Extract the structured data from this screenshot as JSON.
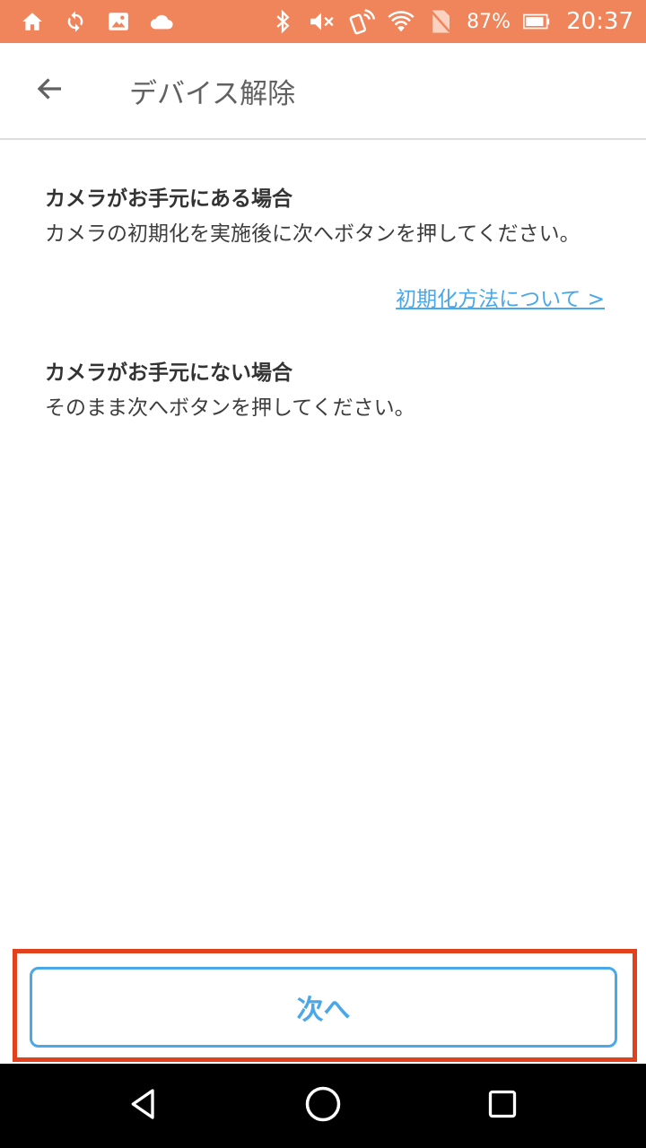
{
  "status_bar": {
    "battery_percent": "87%",
    "time": "20:37"
  },
  "toolbar": {
    "title": "デバイス解除"
  },
  "content": {
    "section1": {
      "heading": "カメラがお手元にある場合",
      "body": "カメラの初期化を実施後に次へボタンを押してください。"
    },
    "help_link": "初期化方法について >",
    "section2": {
      "heading": "カメラがお手元にない場合",
      "body": "そのまま次へボタンを押してください。"
    }
  },
  "footer": {
    "next_label": "次へ"
  },
  "colors": {
    "status_bar": "#f0845a",
    "accent": "#4aa8e8",
    "highlight": "#e2411e"
  }
}
